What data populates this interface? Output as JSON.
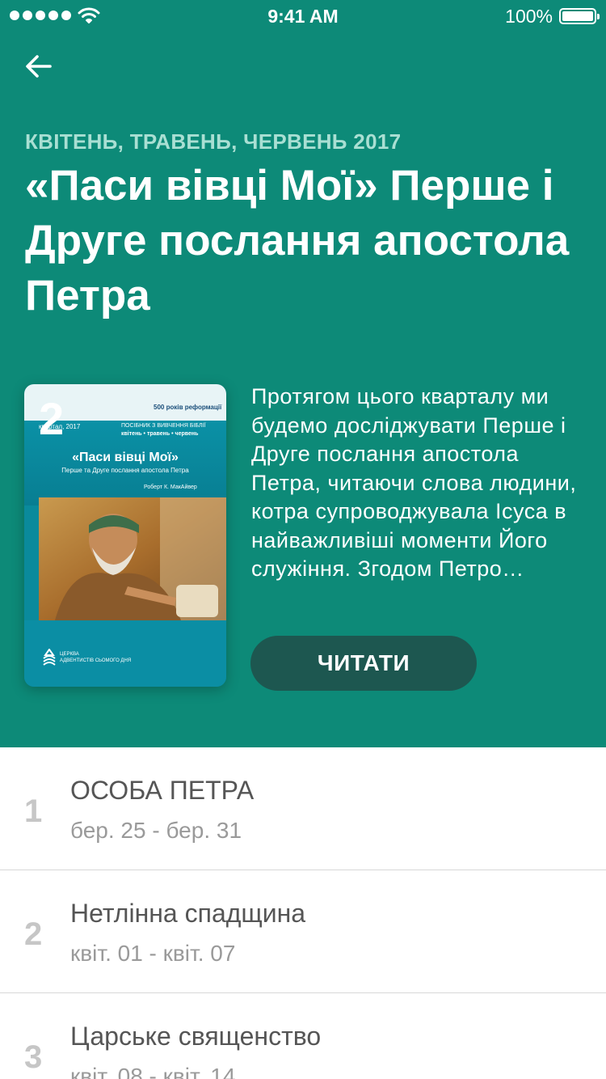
{
  "status_bar": {
    "time": "9:41 AM",
    "battery": "100%"
  },
  "header": {
    "quarter": "КВІТЕНЬ, ТРАВЕНЬ, ЧЕРВЕНЬ 2017",
    "title": "«Паси вівці Мої» Перше і Друге послання апостола Петра",
    "description": "Протягом цього кварталу ми будемо досліджувати Перше і Друге послання апостола Петра, читаючи слова людини, котра супроводжувала Ісуса в найважливіші моменти Його служіння. Згодом Петро…",
    "read_button": "ЧИТАТИ",
    "background_color": "#0d8a78",
    "button_color": "#1d5750"
  },
  "cover": {
    "number": "2",
    "quarter_year": "квартал, 2017",
    "badge": "500 років реформації",
    "guide": "ПОСІБНИК З ВИВЧЕННЯ БІБЛІЇ",
    "months": "квітень • травень • червень",
    "title": "«Паси вівці Мої»",
    "subtitle": "Перше та Друге послання апостола Петра",
    "author": "Роберт К. МакАйвер",
    "church_line1": "ЦЕРКВА",
    "church_line2": "АДВЕНТИСТІВ СЬОМОГО ДНЯ"
  },
  "lessons": [
    {
      "number": "1",
      "title": "ОСОБА ПЕТРА",
      "dates": "бер. 25 - бер. 31"
    },
    {
      "number": "2",
      "title": "Нетлінна спадщина",
      "dates": "квіт. 01 - квіт. 07"
    },
    {
      "number": "3",
      "title": "Царське священство",
      "dates": "квіт. 08 - квіт. 14"
    }
  ],
  "icons": {
    "back": "arrow-left-icon",
    "wifi": "wifi-icon",
    "battery": "battery-icon"
  }
}
